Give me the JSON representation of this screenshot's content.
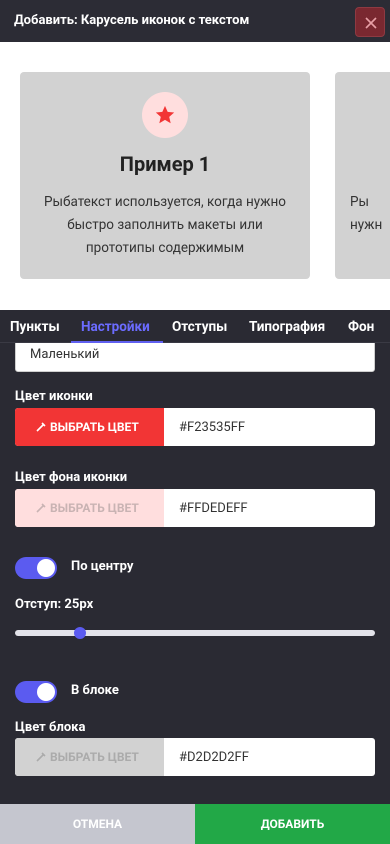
{
  "header": {
    "title": "Добавить: Карусель иконок с текстом",
    "close_icon": "close-icon"
  },
  "preview": {
    "cards": [
      {
        "title": "Пример 1",
        "text": "Рыбатекст используется, когда нужно быстро заполнить макеты или прототипы содержимым",
        "icon": "star-icon"
      },
      {
        "text_clipped_line1": "Ры",
        "text_clipped_line2": "нужн"
      }
    ]
  },
  "tabs": [
    {
      "label": "Пункты",
      "active": false
    },
    {
      "label": "Настройки",
      "active": true
    },
    {
      "label": "Отступы",
      "active": false
    },
    {
      "label": "Типография",
      "active": false
    },
    {
      "label": "Фон",
      "active": false
    }
  ],
  "settings": {
    "size_value": "Маленький",
    "icon_color": {
      "label": "Цвет иконки",
      "button": "ВЫБРАТЬ ЦВЕТ",
      "value": "#F23535FF",
      "swatch": "#F23535"
    },
    "icon_bg_color": {
      "label": "Цвет фона иконки",
      "button": "ВЫБРАТЬ ЦВЕТ",
      "value": "#FFDEDEFF",
      "swatch": "#FFDEDE"
    },
    "center_toggle": {
      "label": "По центру",
      "on": true
    },
    "spacing": {
      "label": "Отступ: 25px",
      "value": 25
    },
    "in_block_toggle": {
      "label": "В блоке",
      "on": true
    },
    "block_color": {
      "label": "Цвет блока",
      "button": "ВЫБРАТЬ ЦВЕТ",
      "value": "#D2D2D2FF",
      "swatch": "#D2D2D2"
    }
  },
  "footer": {
    "cancel": "ОТМЕНА",
    "add": "ДОБАВИТЬ"
  }
}
